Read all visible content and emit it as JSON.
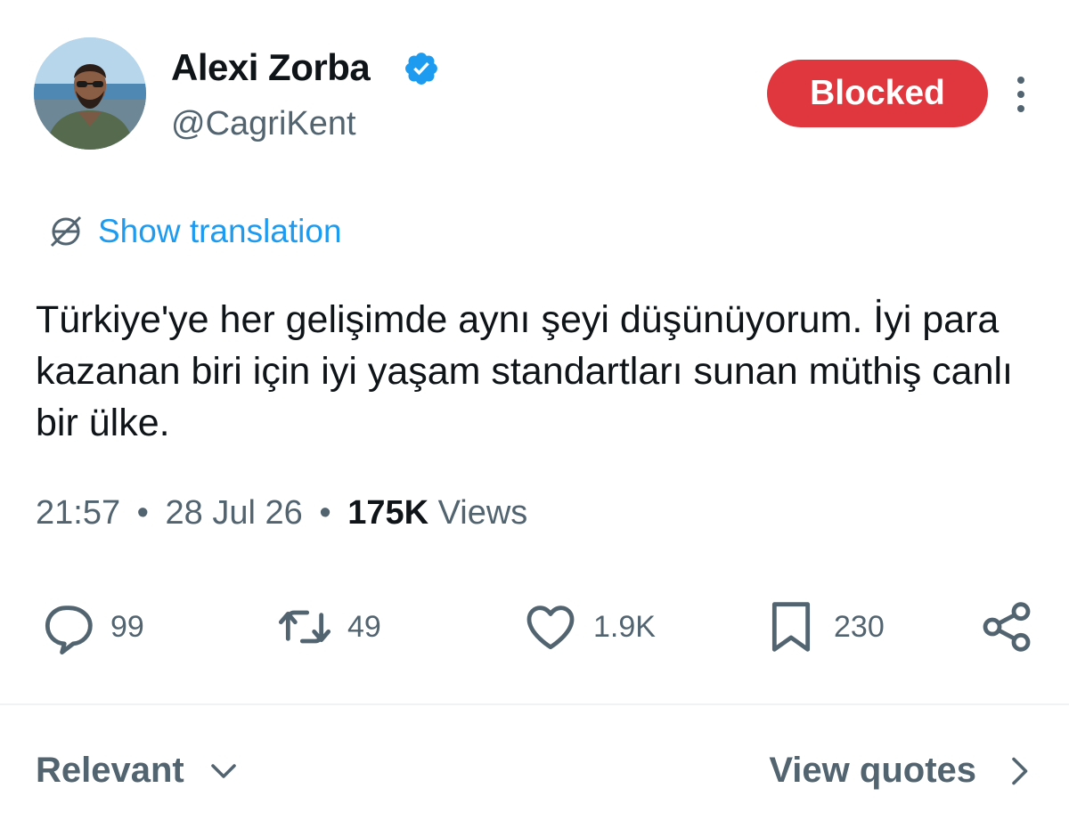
{
  "author": {
    "display_name": "Alexi Zorba",
    "handle": "@CagriKent",
    "verified_badge_color": "#1d9bf0"
  },
  "header": {
    "blocked_label": "Blocked",
    "blocked_color": "#e0373f"
  },
  "translation": {
    "label": "Show translation",
    "icon": "translate-globe-icon"
  },
  "tweet": {
    "text": "Türkiye'ye her gelişimde aynı şeyi düşünüyorum. İyi para kazanan biri için iyi yaşam standartları sunan müthiş canlı bir ülke.",
    "time": "21:57",
    "date": "28 Jul 26",
    "separator": "•",
    "views_count": "175K",
    "views_label": "Views"
  },
  "actions": {
    "replies": "99",
    "retweets": "49",
    "likes": "1.9K",
    "bookmarks": "230"
  },
  "footer": {
    "sort_label": "Relevant",
    "quotes_label": "View quotes"
  },
  "colors": {
    "accent": "#1d9bf0",
    "text_primary": "#0f1419",
    "text_secondary": "#536471"
  }
}
